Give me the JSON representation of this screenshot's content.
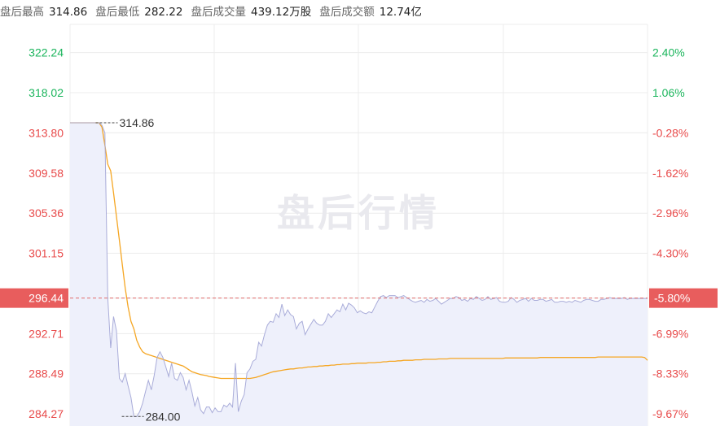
{
  "header": {
    "high_label": "盘后最高",
    "high_value": "314.86",
    "low_label": "盘后最低",
    "low_value": "282.22",
    "volume_label": "盘后成交量",
    "volume_value": "439.12万股",
    "amount_label": "盘后成交额",
    "amount_value": "12.74亿"
  },
  "watermark": "盘后行情",
  "colors": {
    "up": "#1bb55c",
    "down": "#e84b4b",
    "price_line": "#a9acd9",
    "avg_line": "#f5a623",
    "price_tag_bg": "#e85d5d",
    "grid": "#ececec"
  },
  "chart_data": {
    "type": "line",
    "price_axis": [
      "322.24",
      "318.02",
      "313.80",
      "309.58",
      "305.36",
      "301.15",
      "296.44",
      "292.71",
      "288.49",
      "284.27"
    ],
    "pct_axis": [
      "2.40%",
      "1.06%",
      "-0.28%",
      "-1.62%",
      "-2.96%",
      "-4.30%",
      "-5.80%",
      "-6.99%",
      "-8.33%",
      "-9.67%"
    ],
    "ylim": [
      283.0,
      324.0
    ],
    "current_price": "296.44",
    "current_pct": "-5.80%",
    "annotations": [
      {
        "label": "314.86",
        "x": 8,
        "y": 314.86
      },
      {
        "label": "284.00",
        "x": 17,
        "y": 284.0
      }
    ],
    "n_points": 200,
    "series": [
      {
        "values": [
          314.86,
          314.86,
          314.86,
          314.86,
          314.86,
          314.86,
          314.86,
          314.86,
          314.86,
          314.86,
          314.86,
          314.6,
          313.8,
          296.5,
          291.2,
          294.5,
          293.0,
          288.0,
          287.6,
          288.5,
          287.2,
          286.0,
          284.0,
          284.0,
          284.5,
          285.4,
          286.6,
          287.8,
          286.8,
          288.3,
          290.2,
          290.8,
          290.2,
          289.2,
          288.2,
          289.6,
          288.0,
          287.8,
          288.6,
          288.1,
          286.8,
          287.8,
          286.6,
          285.1,
          286.0,
          284.7,
          284.3,
          285.0,
          285.0,
          284.4,
          284.9,
          284.5,
          284.5,
          285.2,
          285.0,
          285.4,
          285.0,
          289.6,
          284.5,
          285.6,
          286.3,
          288.6,
          289.0,
          289.8,
          290.0,
          291.8,
          291.4,
          292.6,
          293.6,
          294.0,
          293.9,
          294.8,
          294.4,
          295.8,
          294.6,
          295.2,
          294.7,
          294.5,
          293.2,
          293.8,
          294.0,
          292.6,
          293.2,
          293.7,
          294.2,
          293.8,
          293.6,
          293.6,
          294.0,
          294.8,
          294.4,
          294.8,
          295.2,
          295.0,
          295.8,
          295.2,
          295.9,
          295.7,
          295.4,
          294.9,
          295.1,
          294.9,
          294.8,
          295.0,
          294.9,
          295.5,
          296.1,
          296.6,
          296.7,
          296.5,
          296.7,
          296.7,
          296.7,
          296.5,
          296.6,
          296.7,
          296.5,
          296.3,
          296.1,
          296.0,
          296.1,
          296.2,
          296.0,
          296.3,
          296.1,
          296.2,
          296.4,
          296.1,
          295.8,
          296.0,
          296.2,
          296.4,
          296.4,
          296.6,
          296.5,
          296.2,
          296.3,
          296.1,
          296.4,
          296.3,
          296.6,
          296.4,
          296.2,
          296.3,
          296.6,
          296.3,
          296.4,
          296.5,
          296.1,
          296.0,
          296.0,
          296.1,
          296.5,
          296.3,
          296.0,
          296.2,
          296.3,
          296.4,
          296.1,
          296.4,
          296.2,
          296.2,
          296.3,
          296.3,
          296.1,
          296.2,
          296.3,
          296.0,
          296.0,
          296.1,
          296.1,
          296.0,
          296.1,
          296.0,
          296.2,
          296.1,
          296.0,
          296.2,
          296.3,
          296.3,
          296.2,
          296.1,
          296.1,
          296.3,
          296.3,
          296.4,
          296.5,
          296.4,
          296.4,
          296.4,
          296.4,
          296.5,
          296.3,
          296.4,
          296.4,
          296.4,
          296.4,
          296.4,
          296.4,
          296.4
        ]
      },
      {
        "values": [
          314.86,
          314.86,
          314.86,
          314.86,
          314.86,
          314.86,
          314.86,
          314.86,
          314.86,
          314.86,
          314.86,
          314.4,
          312.5,
          310.5,
          309.8,
          307.5,
          305.0,
          302.5,
          300.0,
          297.5,
          295.5,
          294.0,
          293.2,
          292.0,
          291.3,
          290.8,
          290.6,
          290.5,
          290.4,
          290.3,
          290.2,
          290.1,
          290.0,
          289.9,
          289.8,
          289.7,
          289.6,
          289.5,
          289.4,
          289.3,
          289.1,
          288.9,
          288.7,
          288.6,
          288.5,
          288.4,
          288.35,
          288.3,
          288.2,
          288.15,
          288.1,
          288.05,
          288.0,
          288.0,
          288.0,
          288.0,
          288.0,
          288.0,
          288.0,
          288.0,
          288.0,
          288.0,
          288.0,
          288.05,
          288.1,
          288.2,
          288.3,
          288.4,
          288.5,
          288.6,
          288.7,
          288.75,
          288.8,
          288.85,
          288.9,
          288.95,
          289.0,
          289.0,
          289.05,
          289.1,
          289.1,
          289.15,
          289.2,
          289.2,
          289.25,
          289.25,
          289.3,
          289.3,
          289.35,
          289.35,
          289.4,
          289.4,
          289.45,
          289.45,
          289.5,
          289.5,
          289.5,
          289.55,
          289.55,
          289.6,
          289.6,
          289.6,
          289.6,
          289.65,
          289.65,
          289.65,
          289.7,
          289.7,
          289.75,
          289.75,
          289.8,
          289.8,
          289.8,
          289.85,
          289.85,
          289.9,
          289.9,
          289.9,
          289.9,
          289.95,
          289.95,
          289.95,
          290.0,
          290.0,
          290.0,
          290.0,
          290.0,
          290.05,
          290.05,
          290.05,
          290.05,
          290.1,
          290.1,
          290.1,
          290.1,
          290.1,
          290.1,
          290.1,
          290.1,
          290.1,
          290.1,
          290.1,
          290.1,
          290.1,
          290.1,
          290.1,
          290.1,
          290.1,
          290.1,
          290.1,
          290.15,
          290.15,
          290.15,
          290.15,
          290.15,
          290.15,
          290.15,
          290.15,
          290.15,
          290.15,
          290.15,
          290.15,
          290.2,
          290.2,
          290.2,
          290.2,
          290.2,
          290.2,
          290.2,
          290.2,
          290.2,
          290.2,
          290.2,
          290.2,
          290.2,
          290.2,
          290.2,
          290.2,
          290.2,
          290.2,
          290.2,
          290.2,
          290.25,
          290.25,
          290.25,
          290.25,
          290.25,
          290.25,
          290.25,
          290.25,
          290.25,
          290.25,
          290.25,
          290.25,
          290.25,
          290.25,
          290.25,
          290.25,
          290.2,
          289.9
        ]
      }
    ]
  }
}
